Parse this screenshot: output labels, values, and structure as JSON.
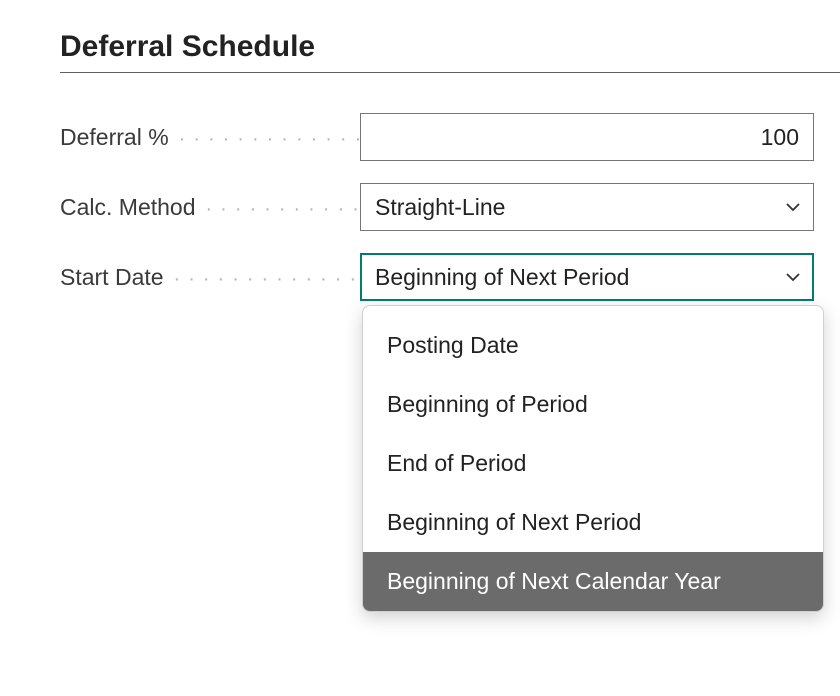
{
  "section": {
    "title": "Deferral Schedule"
  },
  "fields": {
    "deferral_percent": {
      "label": "Deferral %",
      "value": "100"
    },
    "calc_method": {
      "label": "Calc. Method",
      "value": "Straight-Line"
    },
    "start_date": {
      "label": "Start Date",
      "value": "Beginning of Next Period",
      "options": [
        "Posting Date",
        "Beginning of Period",
        "End of Period",
        "Beginning of Next Period",
        "Beginning of Next Calendar Year"
      ],
      "highlighted_index": 4
    }
  },
  "colors": {
    "focus_border": "#047c6c",
    "dropdown_highlight_bg": "#6b6b6b"
  }
}
